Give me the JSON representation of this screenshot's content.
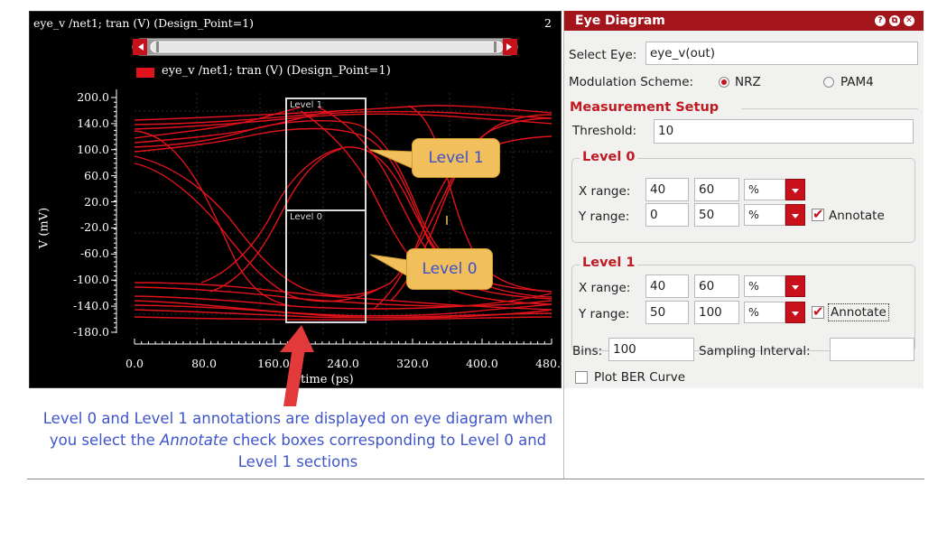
{
  "plot": {
    "title": "eye_v /net1; tran (V) (Design_Point=1)",
    "subwindow_number": "2",
    "legend_label": "eye_v /net1; tran (V) (Design_Point=1)",
    "legend_color": "#e0121b",
    "ylabel": "V (mV)",
    "xlabel": "time (ps)",
    "y_ticks": [
      "200.0",
      "140.0",
      "100.0",
      "60.0",
      "20.0",
      "-20.0",
      "-60.0",
      "-100.0",
      "-140.0",
      "-180.0"
    ],
    "x_ticks": [
      "0.0",
      "80.0",
      "160.0",
      "240.0",
      "320.0",
      "400.0",
      "480.0"
    ],
    "level1_box_label": "Level 1",
    "level0_box_label": "Level 0"
  },
  "callouts": {
    "level1": "Level 1",
    "level0": "Level 0",
    "caption_part1": "Level 0 and Level 1 annotations are displayed on eye diagram when you select the ",
    "caption_italic": "Annotate",
    "caption_part2": " check boxes corresponding to Level 0 and Level 1 sections"
  },
  "panel": {
    "title": "Eye Diagram",
    "window_buttons": [
      "?",
      "⧉",
      "✕"
    ],
    "select_eye_label": "Select Eye:",
    "select_eye_value": "eye_v(out)",
    "modulation_label": "Modulation Scheme:",
    "modulation_options": [
      "NRZ",
      "PAM4"
    ],
    "modulation_selected": "NRZ",
    "measurement_title": "Measurement Setup",
    "threshold_label": "Threshold:",
    "threshold_value": "10",
    "level0": {
      "title": "Level 0",
      "x_range_label": "X range:",
      "x_min": "40",
      "x_max": "60",
      "x_unit": "%",
      "y_range_label": "Y range:",
      "y_min": "0",
      "y_max": "50",
      "y_unit": "%",
      "annotate_label": "Annotate",
      "annotate_checked": true
    },
    "level1": {
      "title": "Level 1",
      "x_range_label": "X range:",
      "x_min": "40",
      "x_max": "60",
      "x_unit": "%",
      "y_range_label": "Y range:",
      "y_min": "50",
      "y_max": "100",
      "y_unit": "%",
      "annotate_label": "Annotate",
      "annotate_checked": true
    },
    "bins_label": "Bins:",
    "bins_value": "100",
    "sampling_label": "Sampling Interval:",
    "sampling_value": "",
    "plot_ber_label": "Plot BER Curve",
    "plot_ber_checked": false
  },
  "colors": {
    "accent": "#a3141b",
    "trace": "#e0121b",
    "caption_text": "#3f55c8",
    "callout_fill": "#f1c05c"
  }
}
